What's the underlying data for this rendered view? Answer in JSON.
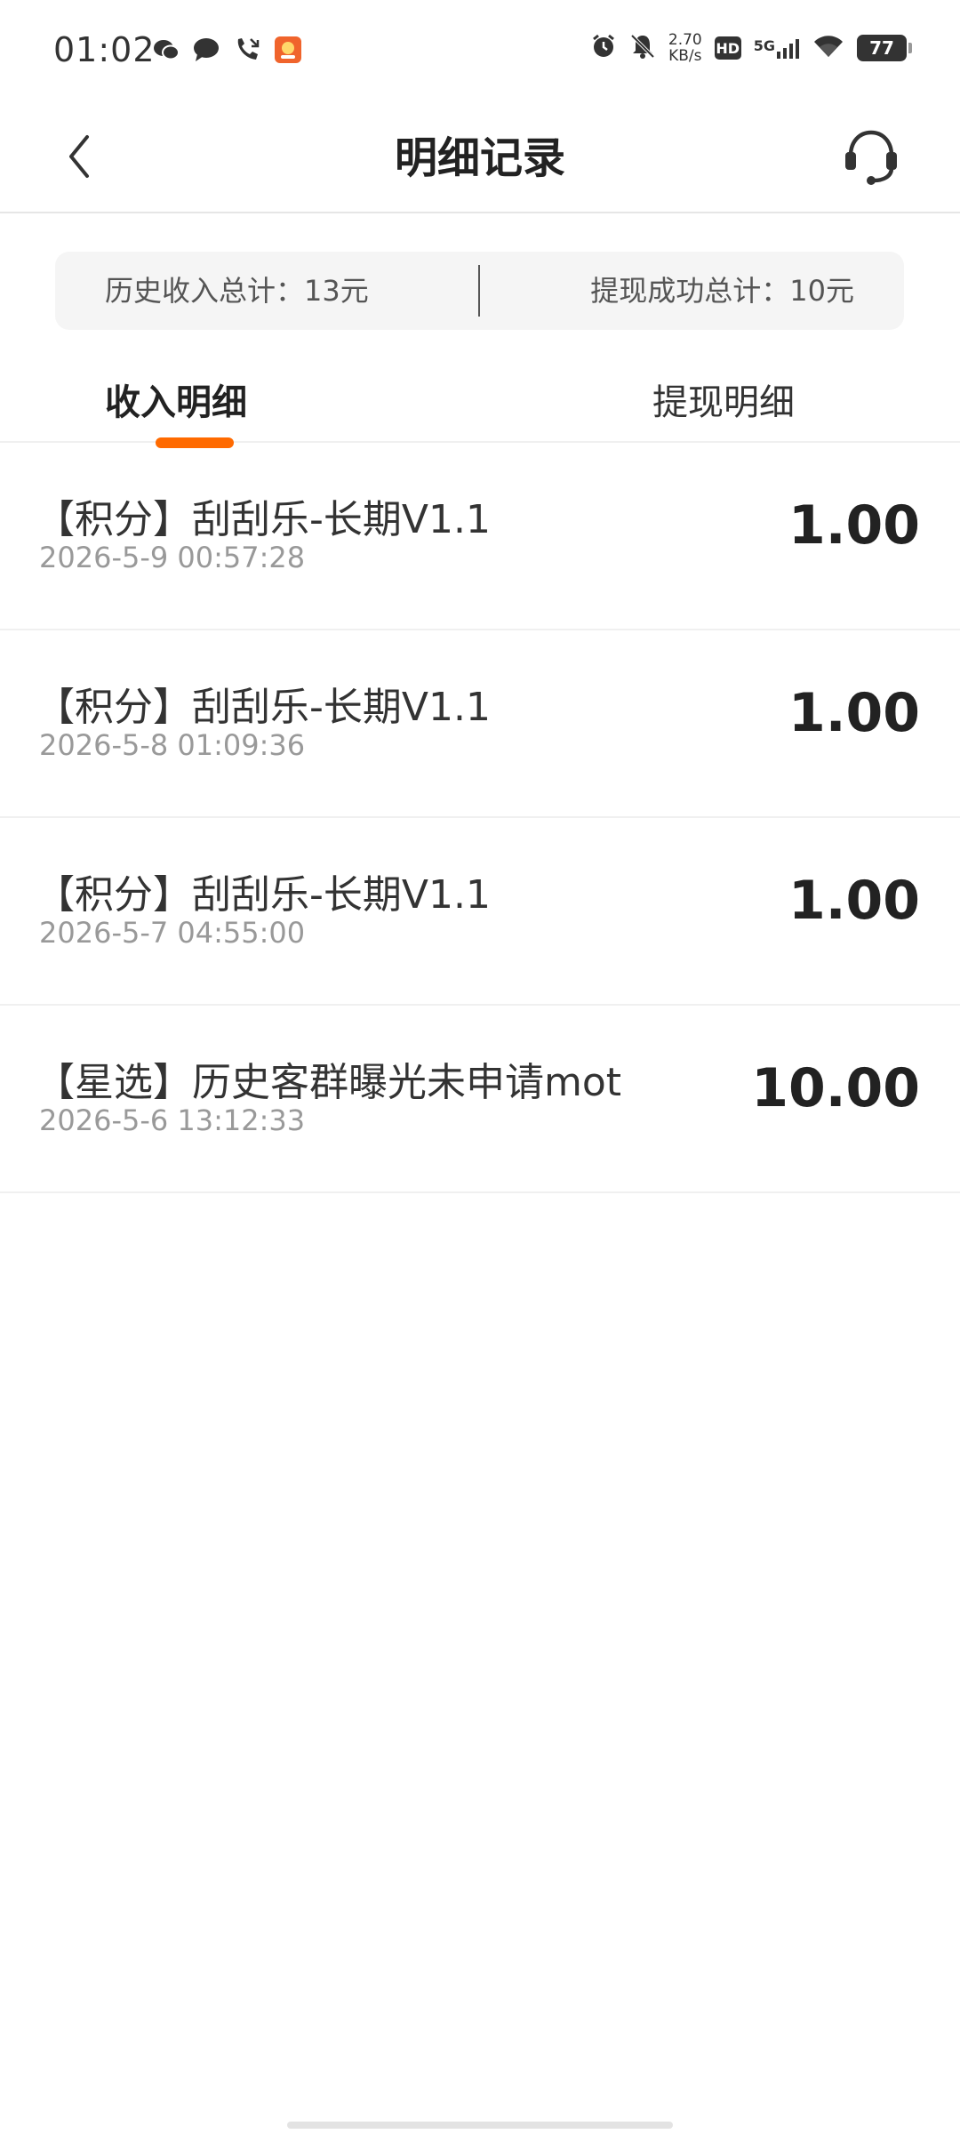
{
  "status_bar": {
    "time": "01:02",
    "net_speed_value": "2.70",
    "net_speed_unit": "KB/s",
    "hd": "HD",
    "signal": "5G",
    "battery": "77",
    "icons": [
      "wechat-icon",
      "message-icon",
      "missed-call-icon",
      "app-notification-icon",
      "alarm-icon",
      "mute-icon",
      "wifi-icon"
    ]
  },
  "header": {
    "title": "明细记录",
    "back_icon": "chevron-left-icon",
    "service_icon": "headset-icon"
  },
  "summary": {
    "income_total": "历史收入总计：13元",
    "withdraw_total": "提现成功总计：10元"
  },
  "tabs": {
    "income": "收入明细",
    "withdraw": "提现明细",
    "active": "income",
    "accent_color": "#ff6a00"
  },
  "records": [
    {
      "title": "【积分】刮刮乐-长期V1.1",
      "time": "2026-5-9 00:57:28",
      "amount": "1.00"
    },
    {
      "title": "【积分】刮刮乐-长期V1.1",
      "time": "2026-5-8 01:09:36",
      "amount": "1.00"
    },
    {
      "title": "【积分】刮刮乐-长期V1.1",
      "time": "2026-5-7 04:55:00",
      "amount": "1.00"
    },
    {
      "title": "【星选】历史客群曝光未申请mot",
      "time": "2026-5-6 13:12:33",
      "amount": "10.00"
    }
  ]
}
